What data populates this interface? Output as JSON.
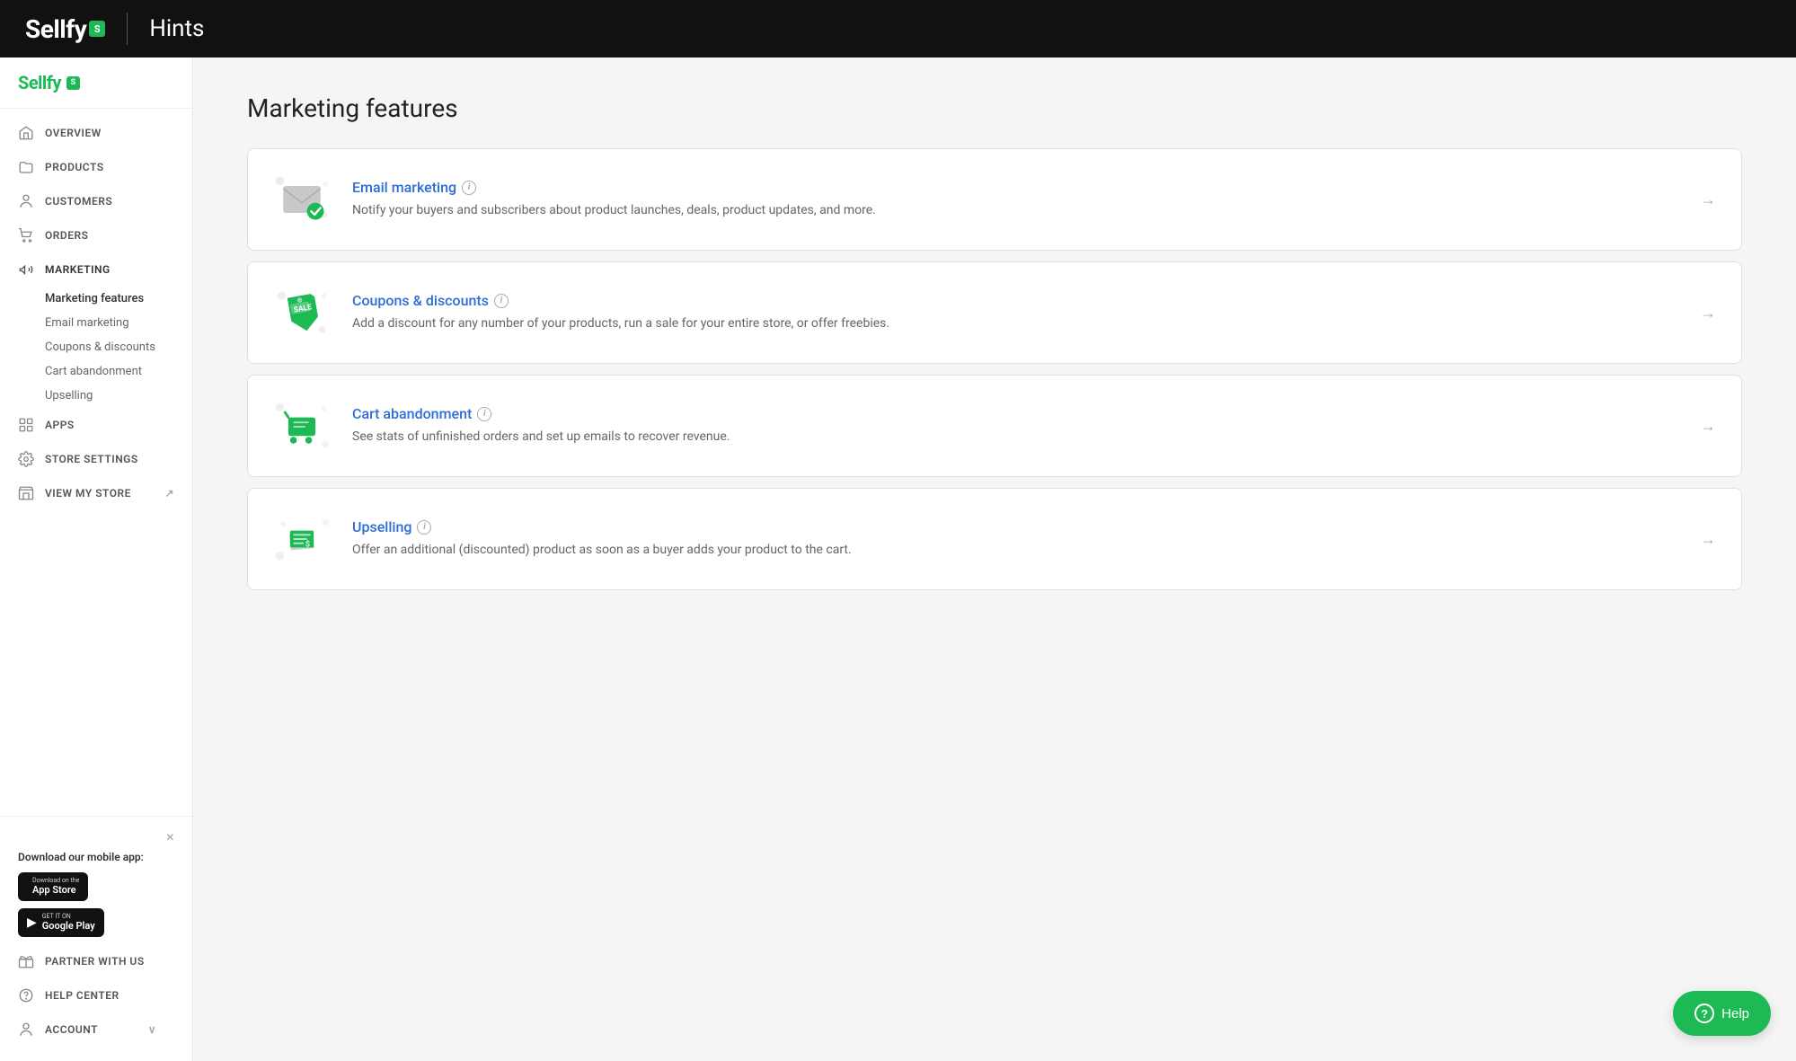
{
  "header": {
    "logo_text": "Sellfy",
    "logo_badge": "S",
    "divider": "|",
    "title": "Hints"
  },
  "sidebar": {
    "brand_text": "Sellfy",
    "brand_badge": "S",
    "nav_items": [
      {
        "id": "overview",
        "label": "OVERVIEW",
        "icon": "home"
      },
      {
        "id": "products",
        "label": "PRODUCTS",
        "icon": "folder"
      },
      {
        "id": "customers",
        "label": "CUSTOMERS",
        "icon": "person"
      },
      {
        "id": "orders",
        "label": "ORDERS",
        "icon": "cart"
      },
      {
        "id": "marketing",
        "label": "MARKETING",
        "icon": "megaphone",
        "active": true
      },
      {
        "id": "apps",
        "label": "APPS",
        "icon": "grid"
      },
      {
        "id": "store-settings",
        "label": "STORE SETTINGS",
        "icon": "gear"
      },
      {
        "id": "view-my-store",
        "label": "VIEW MY STORE",
        "icon": "external"
      }
    ],
    "marketing_sub": [
      {
        "id": "marketing-features",
        "label": "Marketing features",
        "active": true
      },
      {
        "id": "email-marketing",
        "label": "Email marketing"
      },
      {
        "id": "coupons-discounts",
        "label": "Coupons & discounts"
      },
      {
        "id": "cart-abandonment",
        "label": "Cart abandonment"
      },
      {
        "id": "upselling",
        "label": "Upselling"
      }
    ],
    "mobile_app": {
      "title": "Download our mobile app:",
      "app_store_sub": "Download on the",
      "app_store_main": "App Store",
      "google_play_sub": "GET IT ON",
      "google_play_main": "Google Play"
    },
    "footer_items": [
      {
        "id": "partner",
        "label": "PARTNER WITH US",
        "icon": "gift"
      },
      {
        "id": "help-center",
        "label": "HELP CENTER",
        "icon": "question"
      },
      {
        "id": "account",
        "label": "ACCOUNT",
        "icon": "person"
      }
    ]
  },
  "main": {
    "title": "Marketing features",
    "cards": [
      {
        "id": "email-marketing",
        "title": "Email marketing",
        "desc": "Notify your buyers and subscribers about product launches, deals, product updates, and more.",
        "icon_type": "email"
      },
      {
        "id": "coupons-discounts",
        "title": "Coupons & discounts",
        "desc": "Add a discount for any number of your products, run a sale for your entire store, or offer freebies.",
        "icon_type": "coupon"
      },
      {
        "id": "cart-abandonment",
        "title": "Cart abandonment",
        "desc": "See stats of unfinished orders and set up emails to recover revenue.",
        "icon_type": "cart"
      },
      {
        "id": "upselling",
        "title": "Upselling",
        "desc": "Offer an additional (discounted) product as soon as a buyer adds your product to the cart.",
        "icon_type": "upsell"
      }
    ]
  },
  "help_button": {
    "label": "Help",
    "icon": "?"
  }
}
